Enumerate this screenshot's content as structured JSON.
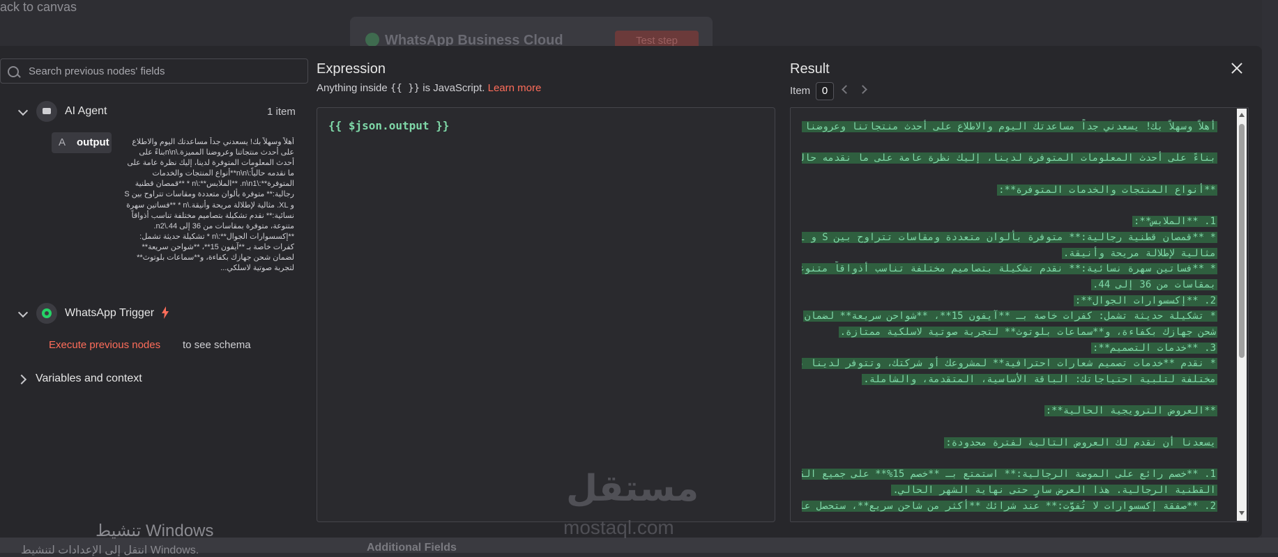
{
  "background": {
    "back_link": "ack to canvas",
    "node_title": "WhatsApp Business Cloud",
    "test_step": "Test step",
    "additional_fields": "Additional Fields"
  },
  "left": {
    "search_placeholder": "Search previous nodes' fields",
    "ai_agent": {
      "label": "AI Agent",
      "count": "1 item"
    },
    "output": {
      "type": "A",
      "label": "output",
      "preview": "أهلاً وسهلاً بك! يسعدني جداً مساعدتك اليوم والاطلاع على أحدث منتجاتنا وعروضنا المميزة.\\n\\nبناءً على أحدث المعلومات المتوفرة لدينا، إليك نظرة عامة على ما نقدمه حالياً:\\n\\n**أنواع المنتجات والخدمات المتوفرة**:\\n\\n1. **الملابس**:\\n * **قمصان قطنية رجالية:** متوفرة بألوان متعددة ومقاسات تتراوح بين S و XL. مثالية لإطلالة مريحة وأنيقة.\\n * **فساتين سهرة نسائية:** نقدم تشكيلة بتصاميم مختلفة تناسب أذواقاً متنوعة، متوفرة بمقاسات من 36 إلى 44.\\n2. **إكسسوارات الجوال**:\\n * تشكيلة حديثة تشمل: كفرات خاصة بـ **آيفون 15**، **شواحن سريعة** لضمان شحن جهازك بكفاءة، و**سماعات بلوتوث** لتجربة صوتية لاسلكي..."
    },
    "whatsapp_trigger": {
      "label": "WhatsApp Trigger"
    },
    "execute_link": "Execute previous nodes",
    "execute_after": "to see schema",
    "variables": "Variables and context"
  },
  "expression": {
    "title": "Expression",
    "subtitle_before": "Anything inside",
    "subtitle_code": "{{ }}",
    "subtitle_after": "is JavaScript.",
    "learn_more": "Learn more",
    "code": "{{ $json.output }}"
  },
  "result": {
    "title": "Result",
    "item_label": "Item",
    "item_value": "0",
    "lines": [
      "أهلاً وسهلاً بك! يسعدني جداً مساعدتك اليوم والاطلاع على أحدث منتجاتنا وعروضنا المميزة.",
      "",
      "بناءً على أحدث المعلومات المتوفرة لدينا، إليك نظرة عامة على ما نقدمه حالياً:",
      "",
      "**أنواع المنتجات والخدمات المتوفرة**:",
      "",
      "1.  **الملابس**:",
      "    *   **قمصان قطنية رجالية:** متوفرة بألوان متعددة ومقاسات تتراوح بين S و XL.",
      "مثالية لإطلالة مريحة وأنيقة.",
      "    *   **فساتين سهرة نسائية:** نقدم تشكيلة بتصاميم مختلفة تناسب أذواقاً متنوعة، متوفرة",
      "بمقاسات من 36 إلى 44.",
      "2.  **إكسسوارات الجوال**:",
      "    *   تشكيلة حديثة تشمل: كفرات خاصة بـ **آيفون 15**، **شواحن سريعة** لضمان",
      "شحن جهازك بكفاءة، و**سماعات بلوتوث** لتجربة صوتية لاسلكية ممتازة.",
      "3.  **خدمات التصميم**:",
      "    *   نقدم **خدمات تصميم شعارات احترافية** لمشروعك أو شركتك، وتتوفر لدينا باقات",
      "مختلفة لتلبية احتياجاتك: الباقة الأساسية، المتقدمة، والشاملة.",
      "",
      "**العروض الترويجية الحالية**:",
      "",
      "يسعدنا أن نقدم لك العروض التالية لفترة محدودة:",
      "",
      "1.  **خصم رائع على الموضة الرجالية:** استمتع بـ **خصم 15%** على جميع القمصان",
      "القطنية الرجالية. هذا العرض سارٍ حتى نهاية الشهر الحالي.",
      "2.  **صفقة إكسسوارات لا تُفوَّت:** عند شرائك **أكثر من شاحن سريع**، ستحصل على"
    ]
  },
  "watermark": {
    "logo": "مستقل",
    "text": "mostaql.com"
  },
  "windows_activation": {
    "line1": "تنشيط Windows",
    "line2": "انتقل إلى الإعدادات لتنشيط Windows."
  }
}
